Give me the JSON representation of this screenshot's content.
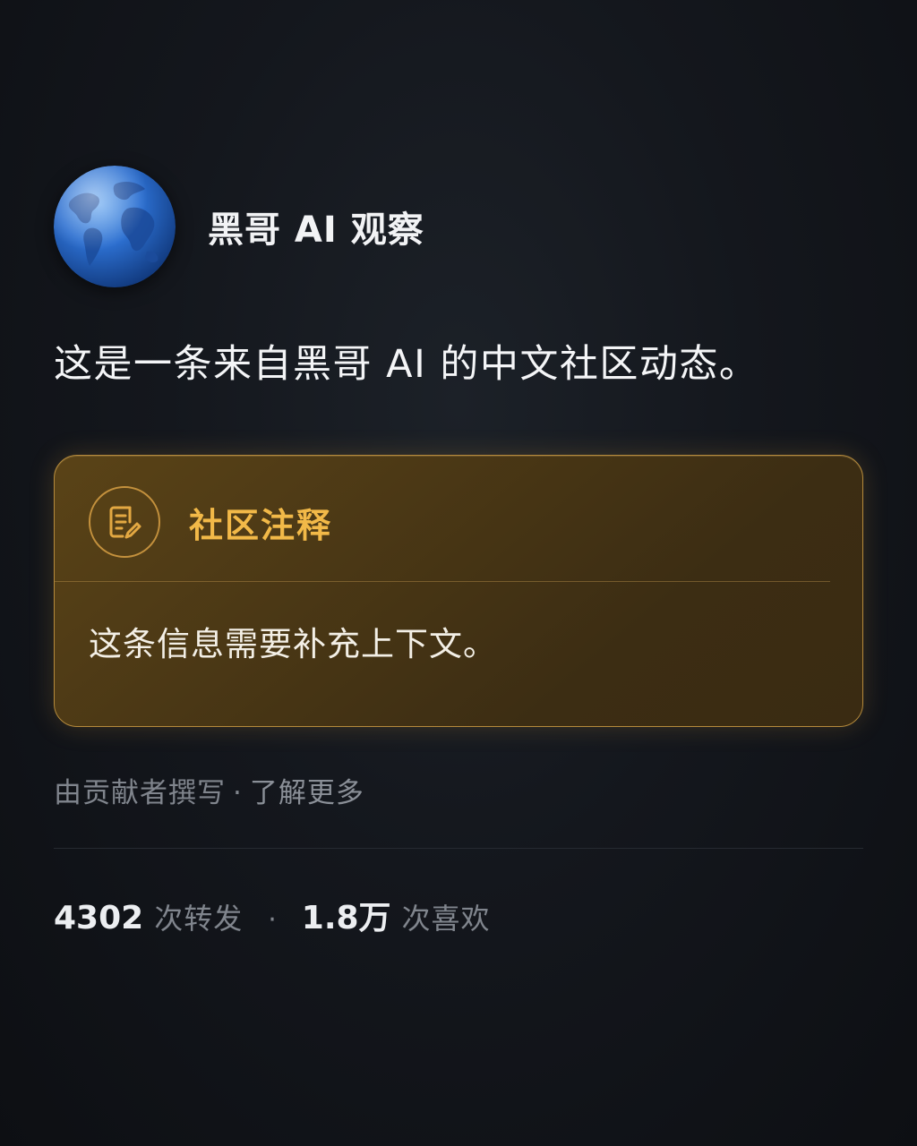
{
  "author": {
    "name": "黑哥 AI 观察",
    "avatar_icon": "globe-icon"
  },
  "post": {
    "text": "这是一条来自黑哥 AI 的中文社区动态。"
  },
  "community_note": {
    "icon": "note-edit-icon",
    "title": "社区注释",
    "body": "这条信息需要补充上下文。",
    "accent_color": "#f2b948",
    "border_color": "#b58a3c"
  },
  "note_meta": {
    "written_by": "由贡献者撰写",
    "separator": "·",
    "learn_more": "了解更多"
  },
  "stats": {
    "reposts_count": "4302",
    "reposts_label": "次转发",
    "separator": "·",
    "likes_count": "1.8万",
    "likes_label": "次喜欢"
  }
}
